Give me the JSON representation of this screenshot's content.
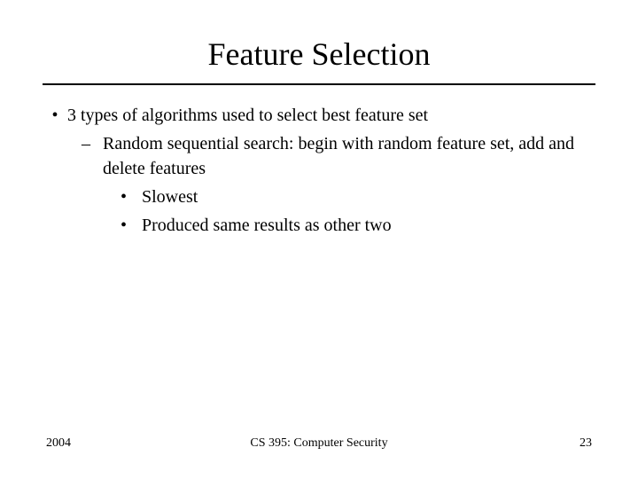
{
  "title": "Feature Selection",
  "bullets": {
    "l1": "3 types of algorithms used to select best feature set",
    "l2": "Random sequential search: begin with random feature set, add and delete features",
    "l3a": "Slowest",
    "l3b": "Produced same results as other two"
  },
  "markers": {
    "l1": "•",
    "l2": "–",
    "l3": "•"
  },
  "footer": {
    "left": "2004",
    "center": "CS 395: Computer Security",
    "right": "23"
  }
}
